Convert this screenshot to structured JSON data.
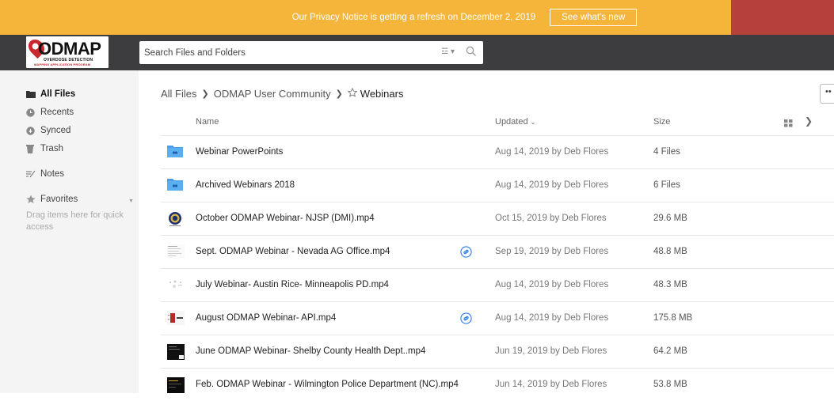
{
  "notice": {
    "message": "Our Privacy Notice is getting a refresh on December 2, 2019",
    "button": "See what's new"
  },
  "logo": {
    "word": "ODMAP",
    "tagline1": "OVERDOSE DETECTION",
    "tagline2": "MAPPING APPLICATION PROGRAM"
  },
  "search": {
    "placeholder": "Search Files and Folders"
  },
  "sidebar": {
    "items": [
      {
        "label": "All Files",
        "icon": "folder-icon",
        "active": true
      },
      {
        "label": "Recents",
        "icon": "clock-icon"
      },
      {
        "label": "Synced",
        "icon": "sync-icon"
      },
      {
        "label": "Trash",
        "icon": "trash-icon"
      },
      {
        "label": "Notes",
        "icon": "notes-icon"
      },
      {
        "label": "Favorites",
        "icon": "star-icon"
      }
    ],
    "drag_hint": "Drag items here for quick access"
  },
  "breadcrumb": {
    "root": "All Files",
    "parent": "ODMAP User Community",
    "current": "Webinars"
  },
  "columns": {
    "name": "Name",
    "updated": "Updated",
    "size": "Size"
  },
  "rows": [
    {
      "name": "Webinar PowerPoints",
      "updated": "Aug 14, 2019 by Deb Flores",
      "size": "4 Files",
      "type": "folder",
      "shared_link": false
    },
    {
      "name": "Archived Webinars 2018",
      "updated": "Aug 14, 2019 by Deb Flores",
      "size": "6 Files",
      "type": "folder",
      "shared_link": false
    },
    {
      "name": "October ODMAP Webinar- NJSP (DMI).mp4",
      "updated": "Oct 15, 2019 by Deb Flores",
      "size": "29.6 MB",
      "type": "video",
      "shared_link": false
    },
    {
      "name": "Sept. ODMAP Webinar - Nevada AG Office.mp4",
      "updated": "Sep 19, 2019 by Deb Flores",
      "size": "48.8 MB",
      "type": "video",
      "shared_link": true
    },
    {
      "name": "July Webinar- Austin Rice- Minneapolis PD.mp4",
      "updated": "Aug 14, 2019 by Deb Flores",
      "size": "48.3 MB",
      "type": "video",
      "shared_link": false
    },
    {
      "name": "August ODMAP Webinar- API.mp4",
      "updated": "Aug 14, 2019 by Deb Flores",
      "size": "175.8 MB",
      "type": "video",
      "shared_link": true
    },
    {
      "name": "June ODMAP Webinar- Shelby County Health Dept..mp4",
      "updated": "Jun 19, 2019 by Deb Flores",
      "size": "64.2 MB",
      "type": "video",
      "shared_link": false
    },
    {
      "name": "Feb. ODMAP Webinar - Wilmington Police Department (NC).mp4",
      "updated": "Jun 14, 2019 by Deb Flores",
      "size": "53.8 MB",
      "type": "video",
      "shared_link": false
    }
  ],
  "colors": {
    "notice_bg": "#f4b53a",
    "header_bg": "#3d3d3f",
    "sidebar_bg": "#f4f4f4",
    "folder_blue": "#4a9ee8",
    "link_blue": "#2b7de9"
  }
}
